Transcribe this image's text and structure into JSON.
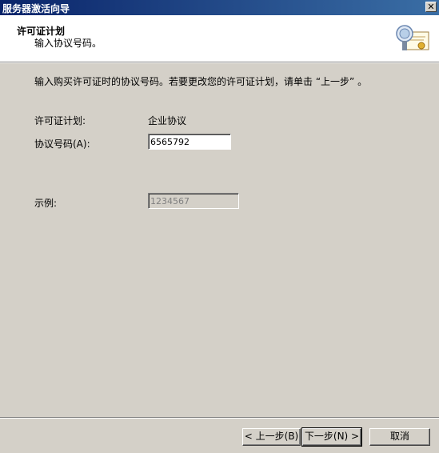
{
  "window": {
    "title": "服务器激活向导",
    "close_glyph": "✕"
  },
  "header": {
    "title": "许可证计划",
    "subtitle": "输入协议号码。",
    "icon": "certificate-icon"
  },
  "body": {
    "instruction": "输入购买许可证时的协议号码。若要更改您的许可证计划，请单击 “上一步” 。",
    "license_plan_label": "许可证计划:",
    "license_plan_value": "企业协议",
    "agreement_label": "协议号码(A):",
    "agreement_value": "6565792",
    "example_label": "示例:",
    "example_value": "1234567"
  },
  "buttons": {
    "back": "< 上一步(B)",
    "next": "下一步(N) >",
    "cancel": "取消"
  },
  "colors": {
    "titlebar": "#0a246a",
    "dialog_bg": "#d4d0c8",
    "header_bg": "#ffffff"
  }
}
